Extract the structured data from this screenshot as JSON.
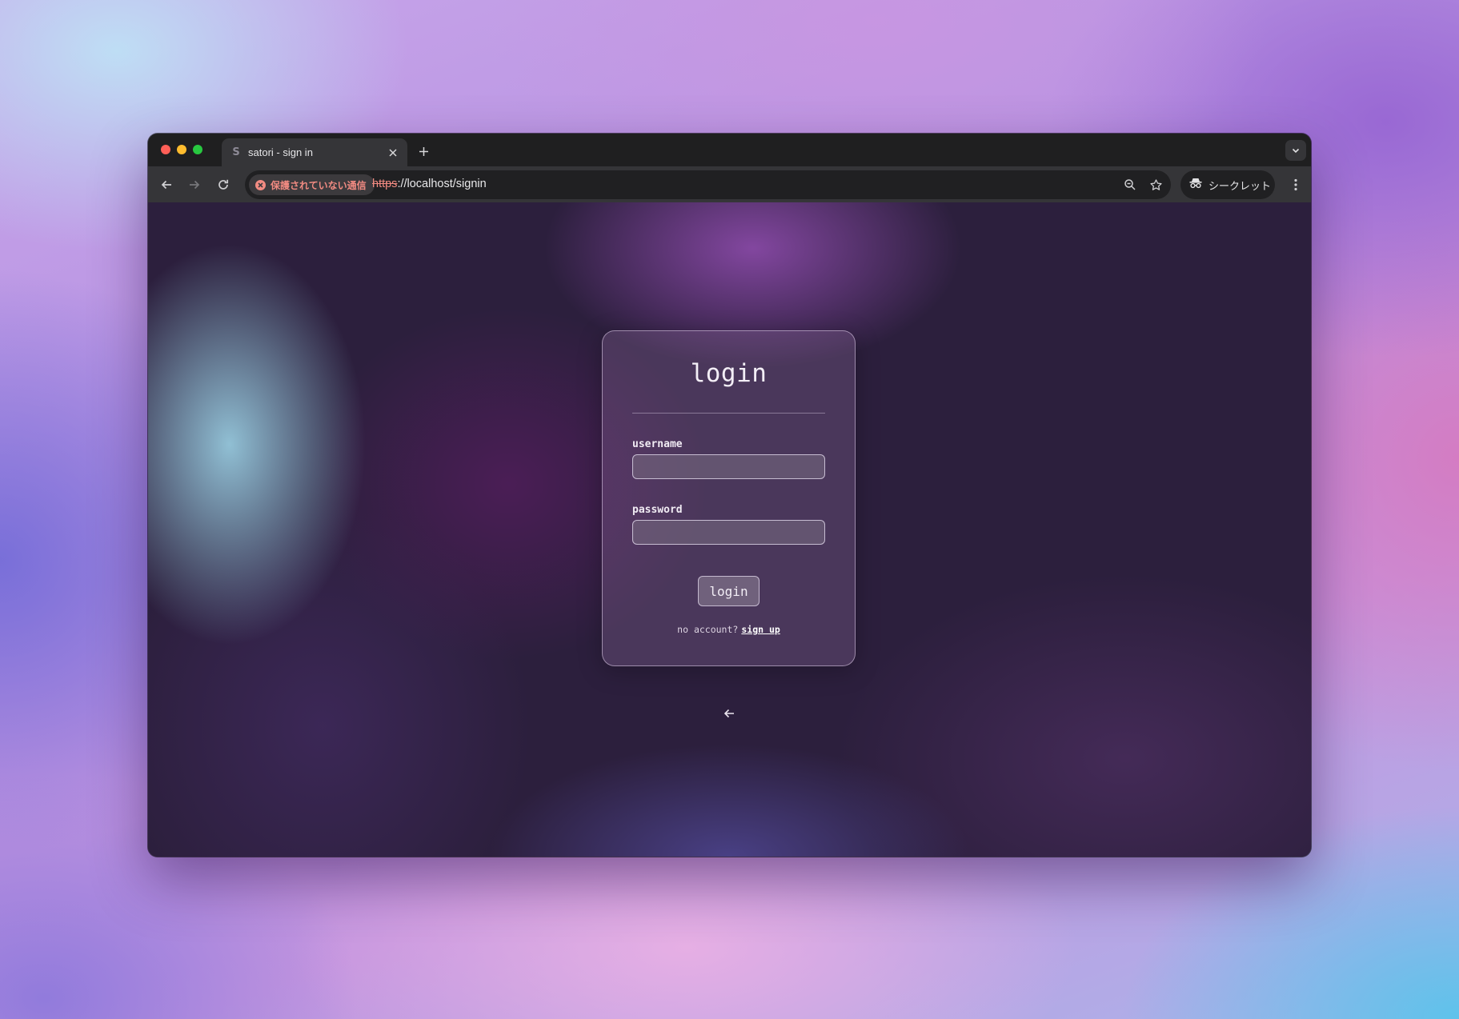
{
  "browser": {
    "tab": {
      "favicon": "S",
      "title": "satori - sign in"
    },
    "address_bar": {
      "security_label": "保護されていない通信",
      "url_scheme": "https",
      "url_rest": "://localhost/signin"
    },
    "profile_label": "シークレット",
    "icons": {
      "back": "back-arrow-icon",
      "forward": "forward-arrow-icon",
      "reload": "reload-icon",
      "zoom": "zoom-icon",
      "bookmark": "star-icon",
      "incognito": "incognito-icon",
      "menu": "kebab-menu-icon",
      "tab_search": "chevron-down-icon"
    }
  },
  "login_form": {
    "title": "login",
    "username_label": "username",
    "username_value": "",
    "password_label": "password",
    "password_value": "",
    "submit_label": "login",
    "no_account_text": "no account?",
    "signup_link": "sign up",
    "back_icon": "left-arrow-icon"
  },
  "colors": {
    "insecure_accent": "#f28b82",
    "browser_chrome": "#353538",
    "page_background": "#2c1f3d"
  }
}
